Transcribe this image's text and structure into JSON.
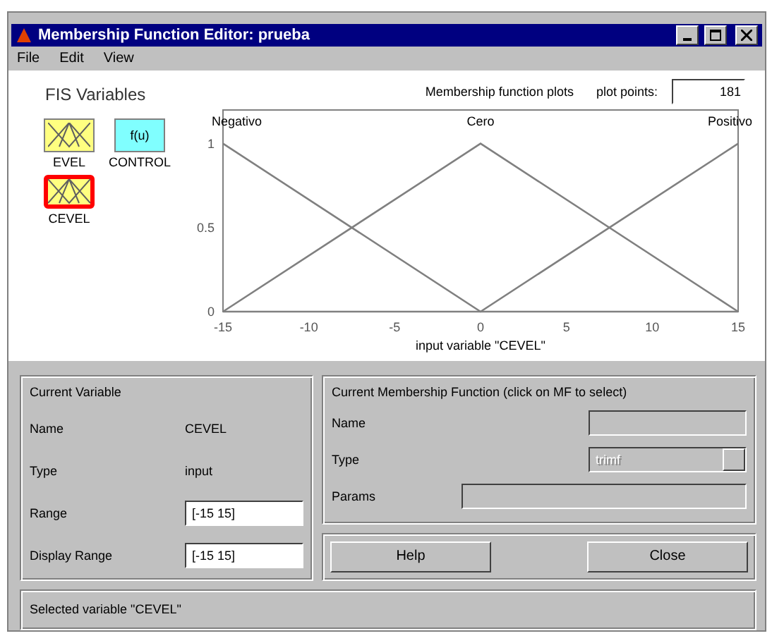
{
  "window": {
    "title": "Membership Function Editor: prueba"
  },
  "menu": [
    "File",
    "Edit",
    "View"
  ],
  "fis_variables": {
    "title": "FIS Variables",
    "items": [
      {
        "name": "EVEL",
        "kind": "input",
        "selected": false
      },
      {
        "name": "CONTROL",
        "kind": "output",
        "symbol": "f(u)",
        "selected": false
      },
      {
        "name": "CEVEL",
        "kind": "input",
        "selected": true
      }
    ]
  },
  "plot": {
    "title": "Membership function plots",
    "plot_points_label": "plot points:",
    "plot_points": "181",
    "chart_data": {
      "type": "line",
      "xlabel": "input variable \"CEVEL\"",
      "x": [
        -15,
        0,
        15
      ],
      "xlim": [
        -15,
        15
      ],
      "ylim": [
        0,
        1.2
      ],
      "xticks": [
        -15,
        -10,
        -5,
        0,
        5,
        10,
        15
      ],
      "yticks": [
        0,
        0.5,
        1
      ],
      "series": [
        {
          "name": "Negativo",
          "color": "#808080",
          "values": [
            1,
            0,
            0
          ]
        },
        {
          "name": "Cero",
          "color": "#808080",
          "values": [
            0,
            1,
            0
          ]
        },
        {
          "name": "Positivo",
          "color": "#808080",
          "values": [
            0,
            0,
            1
          ]
        }
      ]
    }
  },
  "current_variable": {
    "title": "Current Variable",
    "rows": [
      {
        "label": "Name",
        "value": "CEVEL",
        "kind": "text"
      },
      {
        "label": "Type",
        "value": "input",
        "kind": "text"
      },
      {
        "label": "Range",
        "value": "[-15 15]",
        "kind": "field"
      },
      {
        "label": "Display Range",
        "value": "[-15 15]",
        "kind": "field"
      }
    ]
  },
  "current_mf": {
    "title": "Current Membership Function (click on MF to select)",
    "name_label": "Name",
    "type_label": "Type",
    "type_value": "trimf",
    "type_disabled": true,
    "params_label": "Params"
  },
  "buttons": [
    "Help",
    "Close"
  ],
  "status": "Selected variable \"CEVEL\""
}
